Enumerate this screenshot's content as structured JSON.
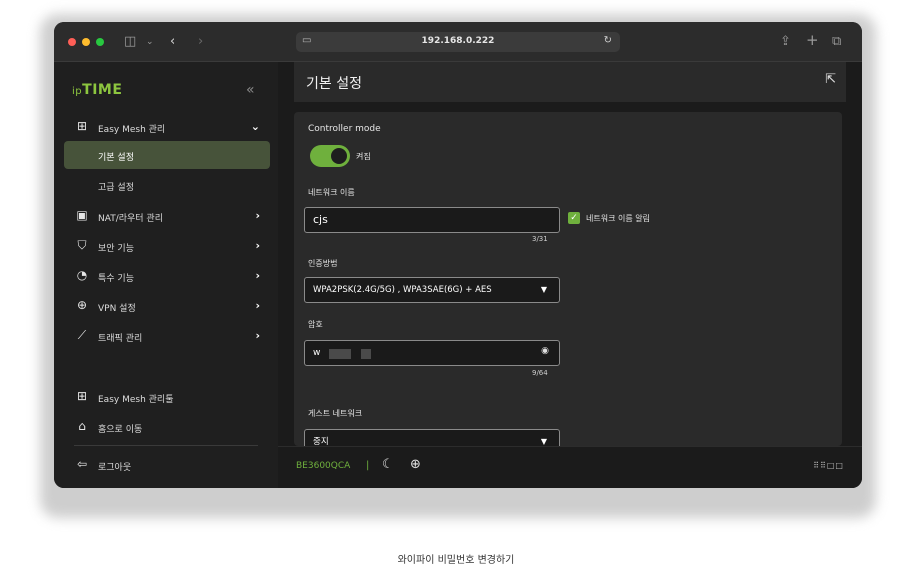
{
  "browser": {
    "url": "192.168.0.222"
  },
  "sidebar": {
    "logo_prefix": "ip",
    "logo_text": "TIME",
    "collapse_glyph": "«",
    "items": [
      {
        "label": "Easy Mesh 관리",
        "icon": "mesh-network-icon"
      },
      {
        "label": "기본 설정",
        "active": true
      },
      {
        "label": "고급 설정"
      },
      {
        "label": "NAT/라우터 관리",
        "icon": "router-icon"
      },
      {
        "label": "보안 기능",
        "icon": "shield-icon"
      },
      {
        "label": "특수 기능",
        "icon": "gauge-icon"
      },
      {
        "label": "VPN 설정",
        "icon": "vpn-globe-icon"
      },
      {
        "label": "트래픽 관리",
        "icon": "traffic-chart-icon"
      }
    ],
    "bottom": [
      {
        "label": "Easy Mesh 관리툴",
        "icon": "mesh-network-icon"
      },
      {
        "label": "홈으로 이동",
        "icon": "home-icon"
      },
      {
        "label": "로그아웃",
        "icon": "logout-icon"
      }
    ]
  },
  "main": {
    "title": "기본 설정",
    "controller_mode": {
      "label": "Controller mode",
      "state_label": "켜짐",
      "on": true
    },
    "network_name": {
      "label": "네트워크 이름",
      "value": "cjs",
      "counter": "3/31",
      "broadcast_label": "네트워크 이름 알림",
      "broadcast_checked": true
    },
    "auth": {
      "label": "인증방법",
      "value": "WPA2PSK(2.4G/5G) , WPA3SAE(6G) + AES"
    },
    "password": {
      "label": "암호",
      "value_visible": "w",
      "counter": "9/64"
    },
    "guest_network": {
      "label": "게스트 네트워크",
      "value": "중지"
    }
  },
  "footer": {
    "model": "BE3600QCA",
    "separator": "|"
  },
  "caption": "와이파이 비밀번호 변경하기",
  "colors": {
    "accent": "#6fb03d",
    "active_nav": "#47533a",
    "background": "#1e1e1e"
  }
}
